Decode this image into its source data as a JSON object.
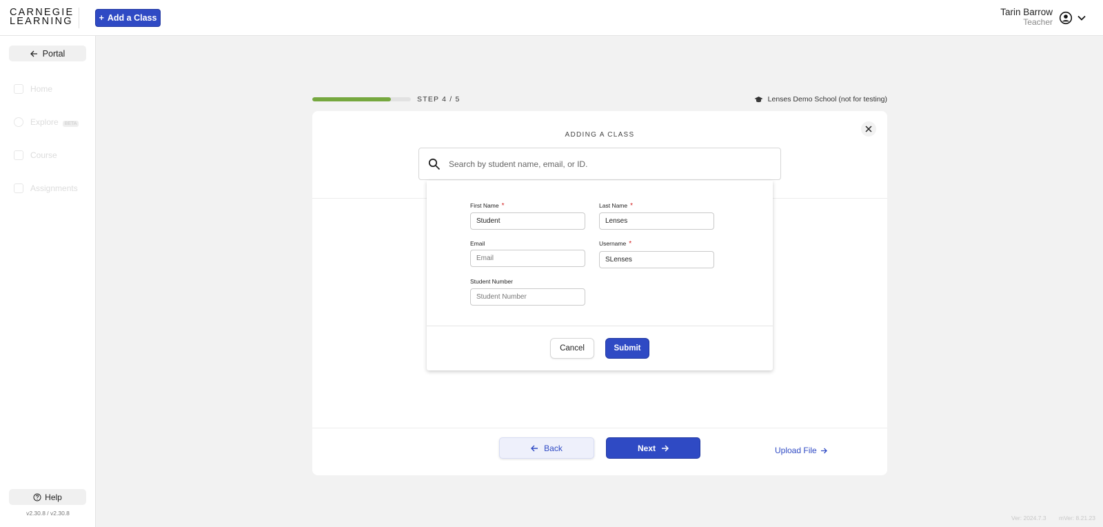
{
  "header": {
    "logo_line1": "CARNEGIE",
    "logo_line2": "LEARNING",
    "add_class_label": "Add a Class",
    "user_name": "Tarin Barrow",
    "user_role": "Teacher"
  },
  "sidebar": {
    "portal_label": "Portal",
    "items": [
      {
        "label": "Home",
        "icon": "home-icon"
      },
      {
        "label": "Explore",
        "icon": "search-icon",
        "badge": "BETA"
      },
      {
        "label": "Course",
        "icon": "course-icon"
      },
      {
        "label": "Assignments",
        "icon": "assignments-icon"
      }
    ],
    "help_label": "Help",
    "version": "v2.30.8 / v2.30.8"
  },
  "wizard": {
    "step_label": "STEP 4 / 5",
    "progress": 0.8,
    "school_name": "Lenses Demo School (not for testing)",
    "title": "ADDING A CLASS",
    "search_placeholder": "Search by student name, email, or ID.",
    "back_label": "Back",
    "next_label": "Next",
    "upload_label": "Upload File"
  },
  "form": {
    "first_name": {
      "label": "First Name",
      "value": "Student",
      "placeholder": "First Name"
    },
    "last_name": {
      "label": "Last Name",
      "value": "Lenses",
      "placeholder": "Last Name"
    },
    "email": {
      "label": "Email",
      "value": "",
      "placeholder": "Email"
    },
    "username": {
      "label": "Username",
      "value": "SLenses",
      "placeholder": "Username"
    },
    "student_number": {
      "label": "Student Number",
      "value": "",
      "placeholder": "Student Number"
    },
    "required_mark": "*",
    "cancel_label": "Cancel",
    "submit_label": "Submit"
  },
  "footer": {
    "ver": "Ver: 2024.7.3",
    "mver": "mVer: 8.21.23"
  },
  "colors": {
    "primary": "#2f4ac4",
    "progress": "#76a83f",
    "required": "#d32020"
  }
}
